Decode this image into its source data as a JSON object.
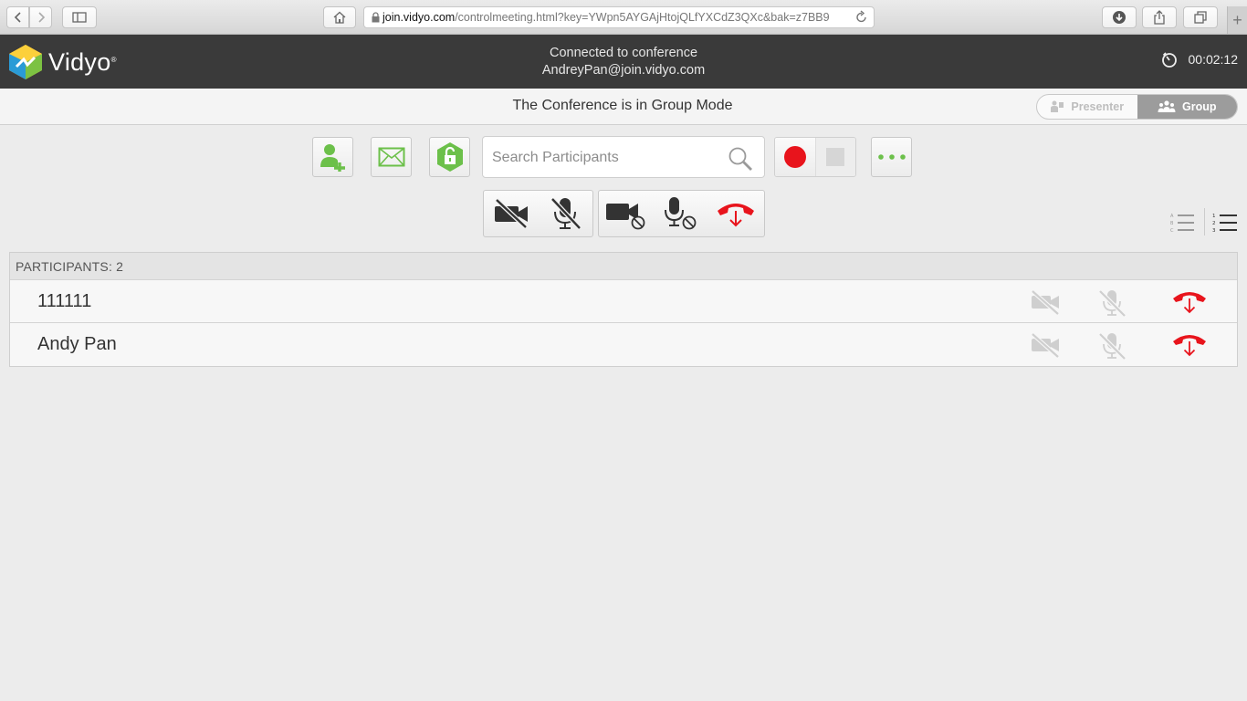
{
  "browser": {
    "url_host": "join.vidyo.com",
    "url_rest": "/controlmeeting.html?key=YWpn5AYGAjHtojQLfYXCdZ3QXc&bak=z7BB9",
    "new_tab": "+"
  },
  "header": {
    "logo_text": "Vidyo",
    "status_line1": "Connected to conference",
    "status_line2": "AndreyPan@join.vidyo.com",
    "timer": "00:02:12"
  },
  "mode": {
    "title": "The Conference is in Group Mode",
    "options": [
      "Presenter",
      "Group"
    ],
    "selected": "Group"
  },
  "toolbar": {
    "search_placeholder": "Search Participants",
    "accent_color": "#6cc04a",
    "record_color": "#e8141c"
  },
  "participants": {
    "header": "PARTICIPANTS: 2",
    "rows": [
      {
        "name": "111111"
      },
      {
        "name": "Andy Pan"
      }
    ]
  }
}
